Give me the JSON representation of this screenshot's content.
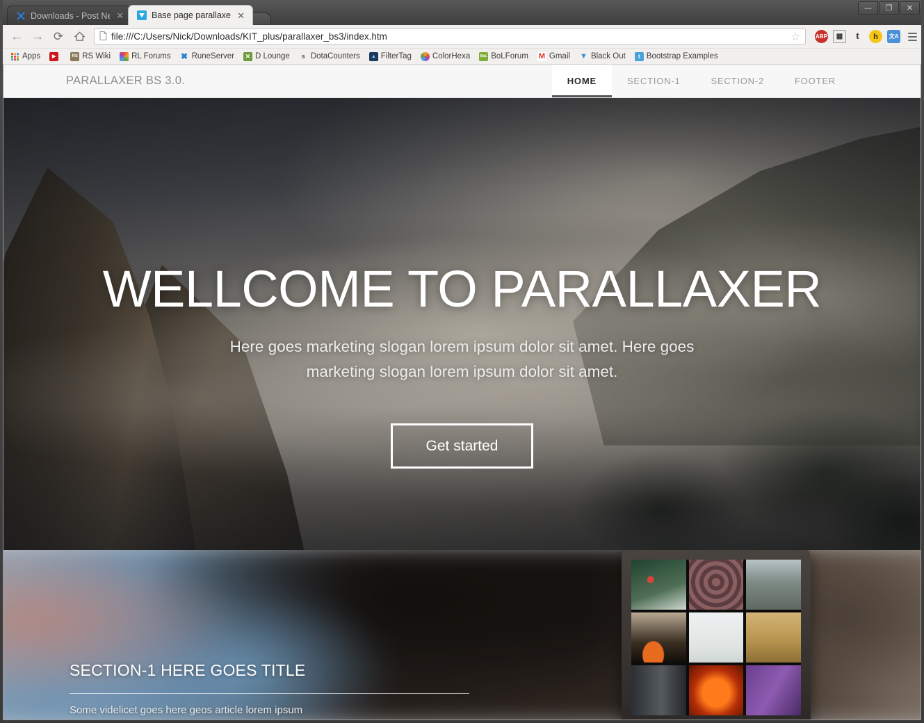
{
  "browser": {
    "window_controls": {
      "minimize": "—",
      "maximize": "❐",
      "close": "✕"
    },
    "tabs": [
      {
        "title": "Downloads - Post New Th",
        "favicon": "runeserver-icon",
        "close": "✕",
        "active": false
      },
      {
        "title": "Base page parallaxer",
        "favicon": "bootstrap-v-icon",
        "close": "✕",
        "active": true
      }
    ],
    "new_tab_label": "",
    "toolbar": {
      "back_icon": "←",
      "forward_icon": "→",
      "reload_icon": "⟳",
      "home_icon": "⌂",
      "page_icon": "📄",
      "url": "file:///C:/Users/Nick/Downloads/KIT_plus/parallaxer_bs3/index.htm",
      "star_icon": "☆",
      "extensions": [
        {
          "name": "adblock-plus-icon",
          "label": "ABP",
          "color": "#c8312b"
        },
        {
          "name": "qr-code-icon",
          "label": "▦",
          "color": "#f1f0ee"
        },
        {
          "name": "tumblr-icon",
          "label": "t",
          "color": "#2b2b2b"
        },
        {
          "name": "honey-icon",
          "label": "h",
          "color": "#f5c518"
        },
        {
          "name": "translate-icon",
          "label": "文A",
          "color": "#4a90d9"
        }
      ],
      "menu_icon": "hamburger-menu-icon"
    },
    "bookmarks": [
      {
        "label": "Apps",
        "icon_color": "#e8a33d"
      },
      {
        "label": "",
        "icon_color": "#cc181e",
        "glyph": "▶"
      },
      {
        "label": "RS Wiki",
        "icon_color": "#8a7a5a",
        "glyph": "RS"
      },
      {
        "label": "RL Forums",
        "icon_color": "#d94b8f",
        "glyph": ""
      },
      {
        "label": "RuneServer",
        "icon_color": "#2a7fd4",
        "glyph": "✖"
      },
      {
        "label": "D Lounge",
        "icon_color": "#6c9b3a",
        "glyph": "✕"
      },
      {
        "label": "DotaCounters",
        "icon_color": "#f1f0ee",
        "glyph": "s"
      },
      {
        "label": "FilterTag",
        "icon_color": "#1f3a5f",
        "glyph": "▲"
      },
      {
        "label": "ColorHexa",
        "icon_color": "#f0a830",
        "glyph": ""
      },
      {
        "label": "BoLForum",
        "icon_color": "#7fae3a",
        "glyph": "BoL"
      },
      {
        "label": "Gmail",
        "icon_color": "#ffffff",
        "glyph": "M"
      },
      {
        "label": "Black Out",
        "icon_color": "#3d8fd4",
        "glyph": "▼"
      },
      {
        "label": "Bootstrap Examples",
        "icon_color": "#4aa3d8",
        "glyph": "t"
      }
    ]
  },
  "page": {
    "navbar": {
      "brand": "PARALLAXER BS 3.0.",
      "items": [
        {
          "label": "HOME",
          "active": true
        },
        {
          "label": "SECTION-1",
          "active": false
        },
        {
          "label": "SECTION-2",
          "active": false
        },
        {
          "label": "FOOTER",
          "active": false
        }
      ]
    },
    "hero": {
      "title": "WELLCOME TO PARALLAXER",
      "subtitle": "Here goes marketing slogan lorem ipsum dolor sit amet. Here goes marketing slogan lorem ipsum dolor sit amet.",
      "cta_label": "Get started"
    },
    "section1": {
      "title": "SECTION-1 HERE GOES TITLE",
      "body": "Some videlicet goes here geos article lorem ipsum"
    }
  }
}
